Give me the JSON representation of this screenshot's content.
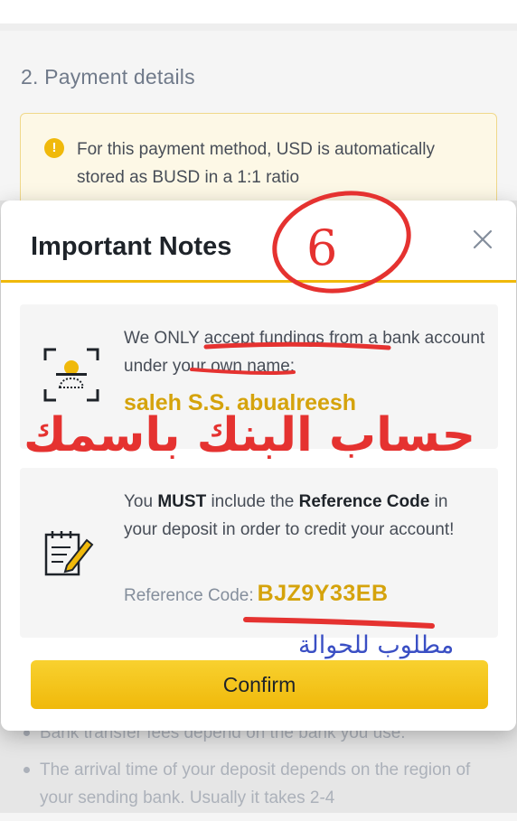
{
  "page": {
    "section_title": "2. Payment details",
    "info_box": {
      "icon": "exclamation-icon",
      "text": "For this payment method, USD is automatically stored as BUSD in a 1:1 ratio"
    },
    "bullets": [
      "Bank transfer fees depend on the bank you use.",
      "The arrival time of your deposit depends on the region of your sending bank. Usually it takes 2-4"
    ]
  },
  "modal": {
    "title": "Important Notes",
    "close_icon": "close-icon",
    "card1": {
      "icon": "id-face-scan-icon",
      "text": "We ONLY accept fundings from a bank account under your own name:",
      "account_name": "saleh S.S. abualreesh"
    },
    "card2": {
      "icon": "notepad-pencil-icon",
      "text_before_must": "You ",
      "must": "MUST",
      "text_mid": " include the ",
      "ref_label_bold": "Reference Code",
      "text_after": " in your deposit in order to credit your account!",
      "ref_label": "Reference Code:",
      "ref_code": "BJZ9Y33EB"
    },
    "confirm_label": "Confirm"
  },
  "annotations": {
    "circled_number": "6",
    "arabic_red": "حساب البنك باسمك",
    "arabic_blue": "مطلوب للحوالة"
  },
  "colors": {
    "accent": "#f0b90b",
    "highlight_text": "#d5a30c",
    "annotation_red": "#e53230",
    "annotation_blue": "#3a4fc4"
  }
}
